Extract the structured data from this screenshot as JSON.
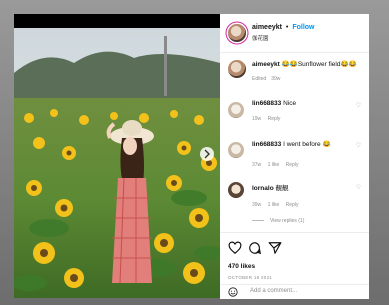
{
  "header": {
    "username": "aimeeykt",
    "separator": "•",
    "follow_label": "Follow",
    "location": "伽花園"
  },
  "caption": {
    "username": "aimeeykt",
    "text": "😂😂Sunflower field😂😂",
    "meta": [
      "Edited",
      "39w"
    ]
  },
  "comments": [
    {
      "username": "lin668833",
      "text": "Nice",
      "time": "19w",
      "reply": "Reply"
    },
    {
      "username": "lin668833",
      "text": "I went before 😂",
      "time": "37w",
      "likes": "1 like",
      "reply": "Reply"
    },
    {
      "username": "lornalo",
      "text": "靚靚",
      "time": "39w",
      "likes": "1 like",
      "reply": "Reply",
      "view_replies": "View replies (1)"
    }
  ],
  "actions": {
    "likes": "470 likes",
    "date": "OCTOBER 19 2021"
  },
  "add_comment": {
    "placeholder": "Add a comment..."
  },
  "colors": {
    "follow": "#0095f6",
    "muted": "#8e8e8e",
    "story_ring": "#d6249f"
  },
  "icons": [
    "heart-icon",
    "comment-icon",
    "share-icon",
    "smile-icon",
    "next-arrow-icon"
  ]
}
